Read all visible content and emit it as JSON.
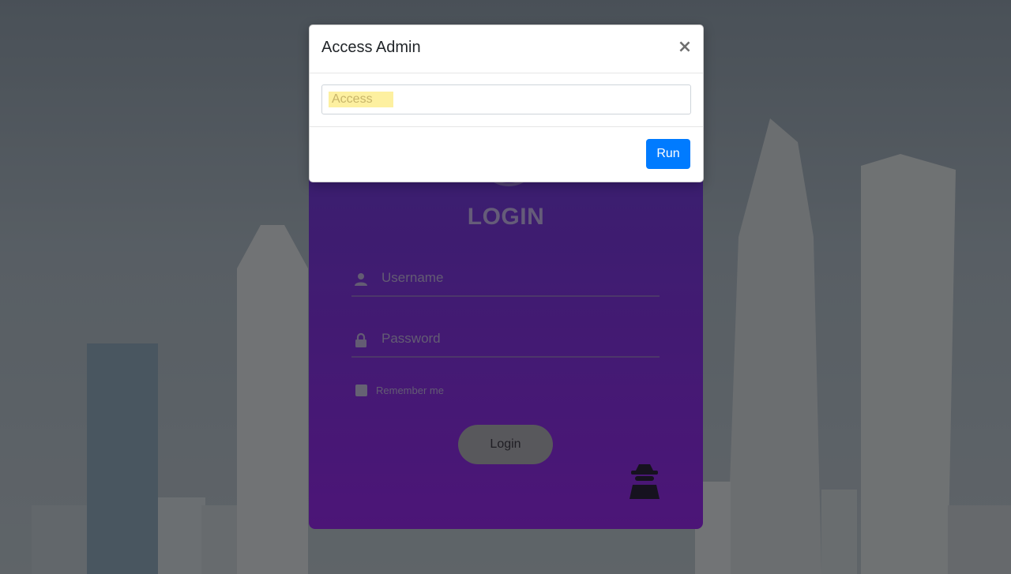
{
  "modal": {
    "title": "Access Admin",
    "close_glyph": "×",
    "input_placeholder": "Access",
    "run_label": "Run"
  },
  "login": {
    "title": "LOGIN",
    "username_placeholder": "Username",
    "password_placeholder": "Password",
    "remember_label": "Remember me",
    "login_label": "Login",
    "icons": [
      "user-icon",
      "lock-icon",
      "spy-icon"
    ]
  },
  "colors": {
    "primary": "#007bff",
    "card_top": "#4a2f96",
    "card_bottom": "#6a1ea6"
  }
}
